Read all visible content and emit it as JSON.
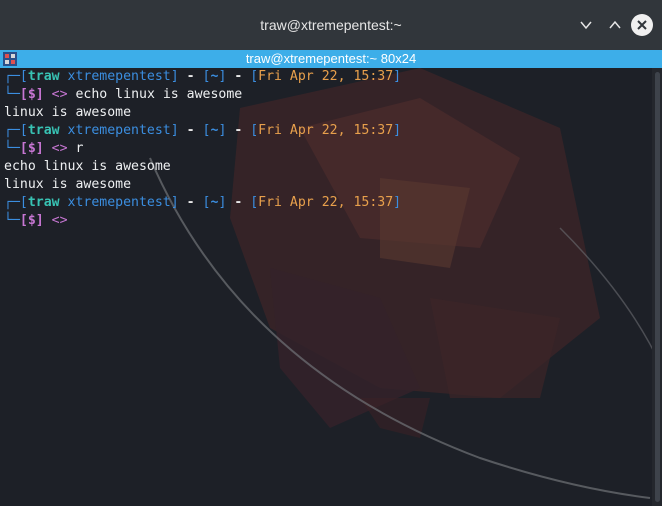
{
  "window": {
    "title": "traw@xtremepentest:~",
    "controls": [
      "chevron-down-icon",
      "chevron-up-icon",
      "close-icon"
    ]
  },
  "tab": {
    "title": "traw@xtremepentest:~ 80x24",
    "icon": "terminal-tab-icon"
  },
  "prompt": {
    "user": "traw",
    "host": "xtremepentest",
    "dir": "~",
    "datetime": "Fri Apr 22, 15:37",
    "symbol": "[$]",
    "arrow": "<>"
  },
  "terminal": {
    "blocks": [
      {
        "command": "echo linux is awesome",
        "output": [
          "linux is awesome"
        ]
      },
      {
        "command": "r",
        "output": [
          "echo linux is awesome",
          "linux is awesome"
        ]
      },
      {
        "command": "",
        "output": []
      }
    ]
  },
  "colors": {
    "accent": "#3daee9",
    "frame": "#3b8ee0",
    "user": "#38c3b4",
    "date": "#e8a04c",
    "prompt_symbol": "#c776d3",
    "terminal_bg": "#1d2027"
  }
}
